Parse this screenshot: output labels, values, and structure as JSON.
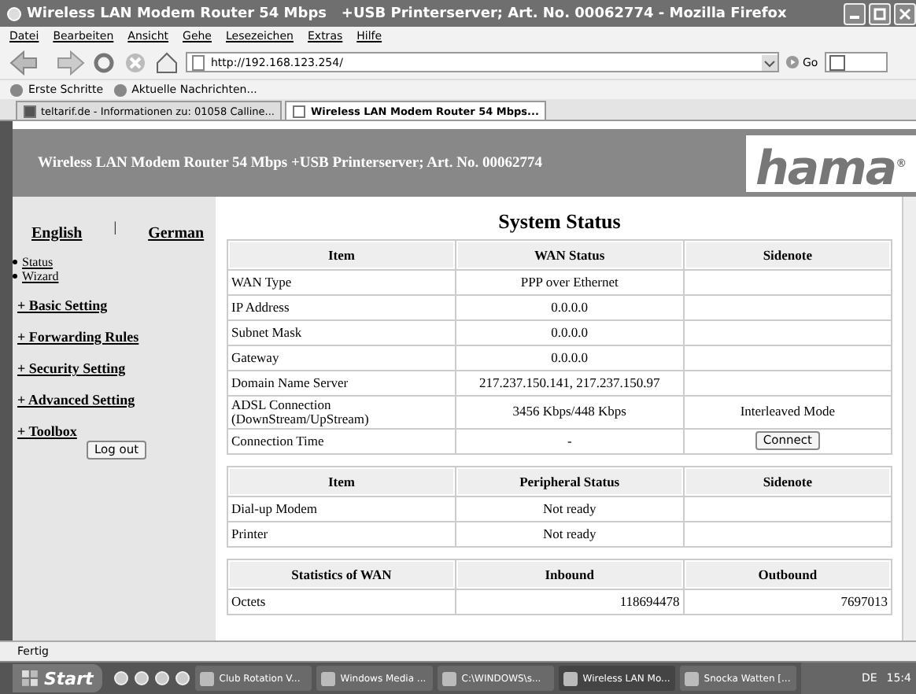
{
  "window": {
    "title": "Wireless LAN Modem Router 54 Mbps   +USB Printerserver; Art. No. 00062774 - Mozilla Firefox"
  },
  "menu": [
    "Datei",
    "Bearbeiten",
    "Ansicht",
    "Gehe",
    "Lesezeichen",
    "Extras",
    "Hilfe"
  ],
  "address": {
    "value": "http://192.168.123.254/",
    "go": "Go"
  },
  "bookmarks": [
    "Erste Schritte",
    "Aktuelle Nachrichten..."
  ],
  "tabs": [
    {
      "label": "teltarif.de - Informationen zu: 01058 Calline...",
      "selected": false
    },
    {
      "label": "Wireless LAN Modem Router 54 Mbps...",
      "selected": true
    }
  ],
  "page": {
    "header": "Wireless LAN Modem Router 54 Mbps +USB Printerserver; Art. No. 00062774",
    "logo": "hama",
    "logo_mark": "®",
    "languages": [
      "English",
      "German"
    ],
    "separator": "|",
    "sidebar": [
      {
        "kind": "bullet",
        "label": "Status"
      },
      {
        "kind": "bullet",
        "label": "Wizard"
      },
      {
        "kind": "section",
        "label": "+ Basic Setting"
      },
      {
        "kind": "section",
        "label": "+ Forwarding Rules"
      },
      {
        "kind": "section",
        "label": "+ Security Setting"
      },
      {
        "kind": "section",
        "label": "+ Advanced Setting"
      },
      {
        "kind": "section",
        "label": "+ Toolbox"
      }
    ],
    "logout": "Log out",
    "heading": "System Status",
    "tables": [
      {
        "columns": [
          "Item",
          "WAN Status",
          "Sidenote"
        ],
        "rows": [
          [
            "WAN Type",
            "PPP over Ethernet",
            ""
          ],
          [
            "IP Address",
            "0.0.0.0",
            ""
          ],
          [
            "Subnet Mask",
            "0.0.0.0",
            ""
          ],
          [
            "Gateway",
            "0.0.0.0",
            ""
          ],
          [
            "Domain Name Server",
            "217.237.150.141, 217.237.150.97",
            ""
          ],
          [
            "ADSL Connection (DownStream/UpStream)",
            "3456 Kbps/448 Kbps",
            "Interleaved Mode"
          ],
          [
            "Connection Time",
            "-",
            {
              "kind": "button",
              "label": "Connect"
            }
          ]
        ]
      },
      {
        "columns": [
          "Item",
          "Peripheral Status",
          "Sidenote"
        ],
        "rows": [
          [
            "Dial-up Modem",
            "Not ready",
            ""
          ],
          [
            "Printer",
            "Not ready",
            ""
          ]
        ]
      },
      {
        "columns": [
          "Statistics of WAN",
          "Inbound",
          "Outbound"
        ],
        "numeric": true,
        "rows": [
          [
            "Octets",
            "118694478",
            "7697013"
          ]
        ]
      }
    ]
  },
  "status_bar": "Fertig",
  "taskbar": {
    "start": "Start",
    "tasks": [
      {
        "label": "Club Rotation V...",
        "selected": false
      },
      {
        "label": "Windows Media ...",
        "selected": false
      },
      {
        "label": "C:\\WINDOWS\\s...",
        "selected": false
      },
      {
        "label": "Wireless LAN Mo...",
        "selected": true
      },
      {
        "label": "Snocka Watten [...",
        "selected": false
      }
    ],
    "language": "DE",
    "clock": "15:4"
  }
}
